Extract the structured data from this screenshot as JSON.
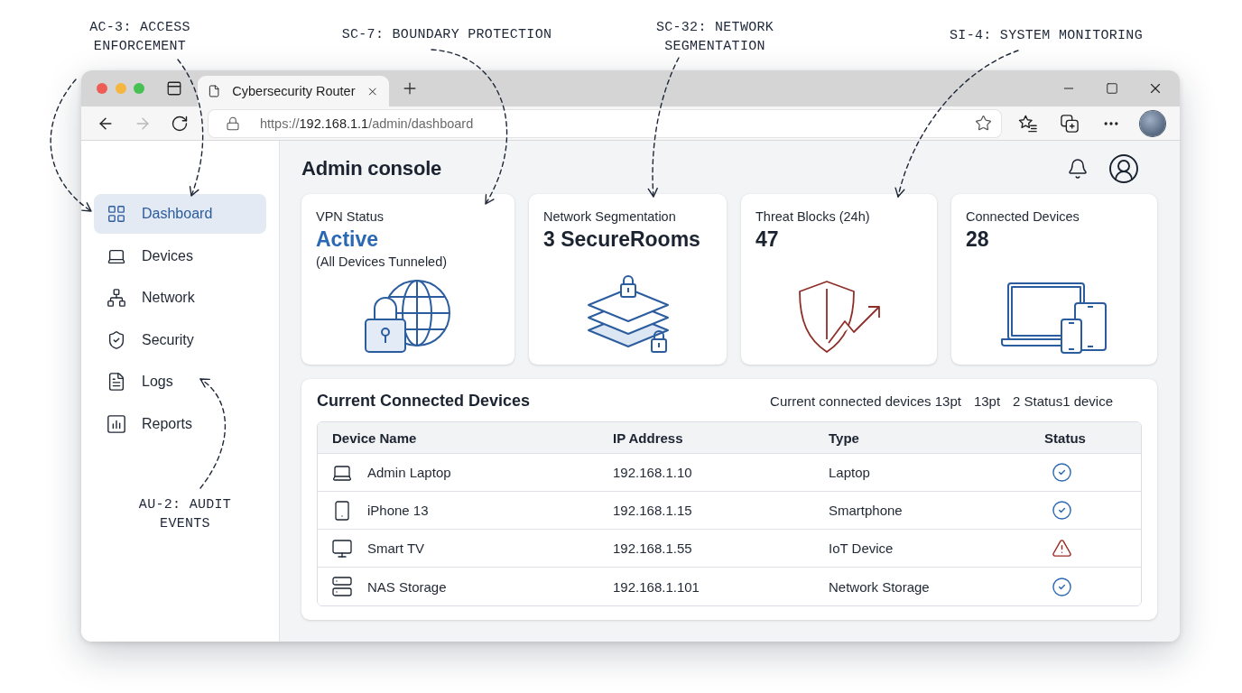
{
  "annotations": [
    {
      "text": "AC-3: ACCESS ENFORCEMENT"
    },
    {
      "text": "SC-7: BOUNDARY PROTECTION"
    },
    {
      "text": "SC-32: NETWORK SEGMENTATION"
    },
    {
      "text": "SI-4: SYSTEM MONITORING"
    },
    {
      "text": "AU-2: AUDIT EVENTS"
    }
  ],
  "window": {
    "tabs": [
      {
        "title": "Cybersecurity Router",
        "selected": true
      }
    ],
    "nav_buttons": [
      {
        "kind": "back",
        "disabled": false
      },
      {
        "kind": "forward",
        "disabled": true
      },
      {
        "kind": "reload",
        "disabled": false
      }
    ],
    "address": {
      "scheme": "https://",
      "host": "192.168.1.1",
      "path": "/admin/dashboard"
    }
  },
  "sidebar": {
    "items": [
      {
        "kind": "dashboard",
        "label": "Dashboard",
        "selected": true
      },
      {
        "kind": "devices",
        "label": "Devices",
        "selected": false
      },
      {
        "kind": "network",
        "label": "Network",
        "selected": false
      },
      {
        "kind": "security",
        "label": "Security",
        "selected": false
      },
      {
        "kind": "logs",
        "label": "Logs",
        "selected": false
      },
      {
        "kind": "reports",
        "label": "Reports",
        "selected": false
      }
    ]
  },
  "header": {
    "title": "Admin console"
  },
  "cards": [
    {
      "kind": "vpn",
      "label": "VPN Status",
      "value": "Active",
      "note": "(All Devices Tunneled)",
      "highlight": true
    },
    {
      "kind": "segments",
      "label": "Network Segmentation",
      "value": "3 SecureRooms",
      "highlight": false
    },
    {
      "kind": "threats",
      "label": "Threat Blocks (24h)",
      "value": "47",
      "highlight": false
    },
    {
      "kind": "devices",
      "label": "Connected Devices",
      "value": "28",
      "highlight": false
    }
  ],
  "devices_panel": {
    "title": "Current Connected Devices",
    "summary": [
      "Current connected devices 13pt",
      "13pt",
      "2 Status1 device"
    ],
    "table": {
      "columns": [
        "Device Name",
        "IP Address",
        "Type",
        "Status"
      ],
      "rows": [
        {
          "kind": "laptop",
          "name": "Admin Laptop",
          "ip": "192.168.1.10",
          "type": "Laptop",
          "alert": false
        },
        {
          "kind": "phone",
          "name": "iPhone 13",
          "ip": "192.168.1.15",
          "type": "Smartphone",
          "alert": false
        },
        {
          "kind": "tv",
          "name": "Smart TV",
          "ip": "192.168.1.55",
          "type": "IoT Device",
          "alert": true
        },
        {
          "kind": "storage",
          "name": "NAS Storage",
          "ip": "192.168.1.101",
          "type": "Network Storage",
          "alert": false
        }
      ]
    }
  }
}
